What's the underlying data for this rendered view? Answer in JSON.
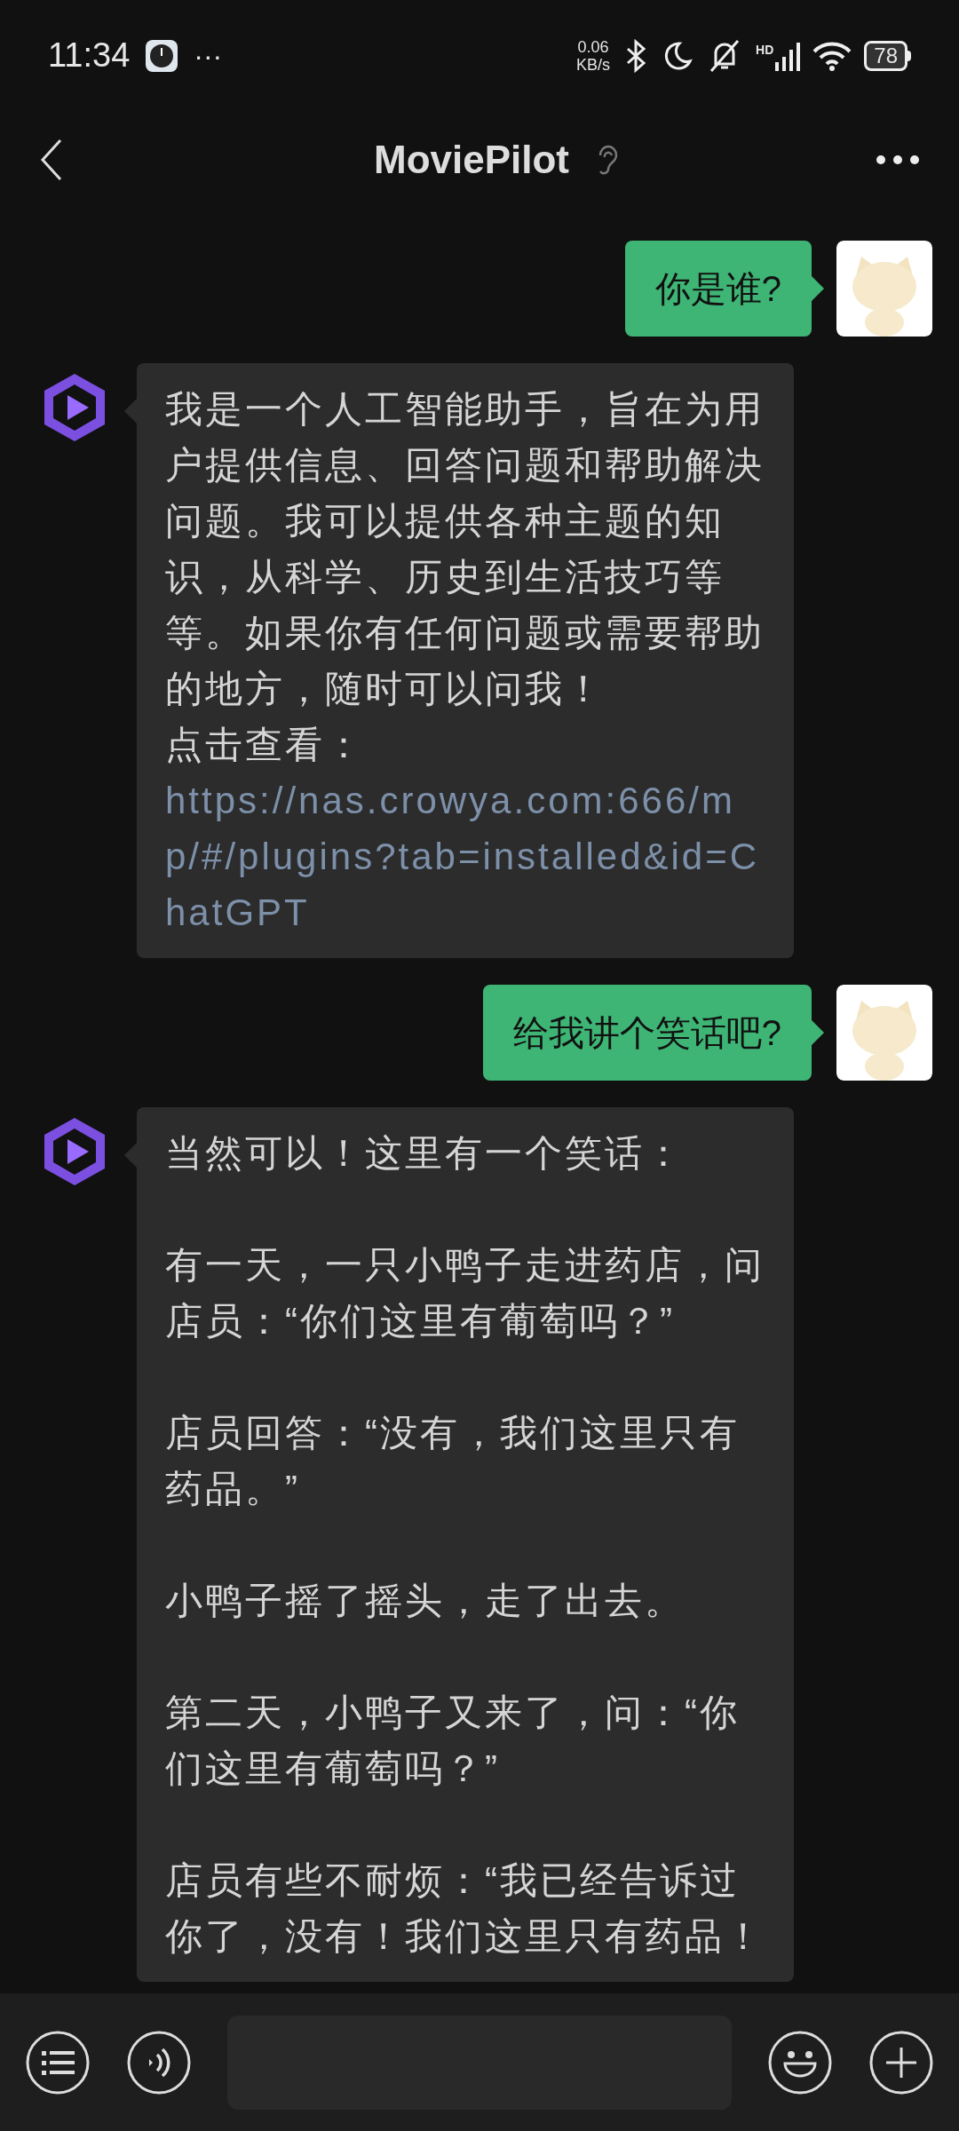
{
  "status_bar": {
    "time": "11:34",
    "more": "···",
    "speed_value": "0.06",
    "speed_unit": "KB/s",
    "network": "HD",
    "battery": "78"
  },
  "header": {
    "title": "MoviePilot"
  },
  "messages": [
    {
      "kind": "sent",
      "paragraphs": [
        "你是谁?"
      ]
    },
    {
      "kind": "received",
      "paragraphs": [
        "我是一个人工智能助手，旨在为用户提供信息、回答问题和帮助解决问题。我可以提供各种主题的知识，从科学、历史到生活技巧等等。如果你有任何问题或需要帮助的地方，随时可以问我！"
      ],
      "link_label": "点击查看：",
      "link": "https://nas.crowya.com:666/mp/#/plugins?tab=installed&id=ChatGPT"
    },
    {
      "kind": "sent",
      "paragraphs": [
        "给我讲个笑话吧?"
      ]
    },
    {
      "kind": "received",
      "paragraphs": [
        "当然可以！这里有一个笑话：",
        "有一天，一只小鸭子走进药店，问店员：“你们这里有葡萄吗？”",
        "店员回答：“没有，我们这里只有药品。”",
        "小鸭子摇了摇头，走了出去。",
        "第二天，小鸭子又来了，问：“你们这里有葡萄吗？”",
        "店员有些不耐烦：“我已经告诉过你了，没有！我们这里只有药品！"
      ]
    }
  ]
}
